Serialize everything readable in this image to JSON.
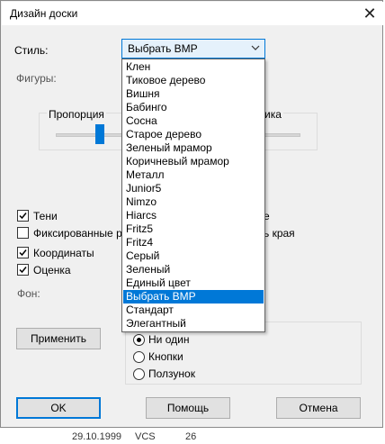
{
  "window": {
    "title": "Дизайн доски",
    "close_glyph": "✕"
  },
  "style": {
    "label": "Стиль:",
    "selected": "Выбрать BMP",
    "options": [
      "Клен",
      "Тиковое дерево",
      "Вишня",
      "Бабинго",
      "Сосна",
      "Старое дерево",
      "Зеленый мрамор",
      "Коричневый мрамор",
      "Металл",
      "Junior5",
      "Nimzo",
      "Hiarcs",
      "Fritz5",
      "Fritz4",
      "Серый",
      "Зеленый",
      "Единый цвет",
      "Выбрать BMP",
      "Стандарт",
      "Элегантный"
    ],
    "selected_index": 17
  },
  "figures_label": "Фигуры:",
  "slider": {
    "left_label": "Пропорция",
    "right_label_partial": "ика"
  },
  "checkboxes": [
    {
      "label": "Тени",
      "checked": true
    },
    {
      "label": "Фиксированные р",
      "checked": false
    },
    {
      "label": "Координаты",
      "checked": true
    },
    {
      "label": "Оценка",
      "checked": true
    }
  ],
  "right_partial": {
    "row1": "е",
    "row2": "ь края"
  },
  "background_label": "Фон:",
  "apply_button": "Применить",
  "radios": [
    {
      "label": "Ни один",
      "selected": true
    },
    {
      "label": "Кнопки",
      "selected": false
    },
    {
      "label": "Ползунок",
      "selected": false
    }
  ],
  "buttons": {
    "ok": "OK",
    "help": "Помощь",
    "cancel": "Отмена"
  },
  "behind": {
    "date": "29.10.1999",
    "code": "VCS",
    "num": "26"
  },
  "colors": {
    "accent": "#0078d7",
    "dialog_bg": "#f0f0f0"
  }
}
